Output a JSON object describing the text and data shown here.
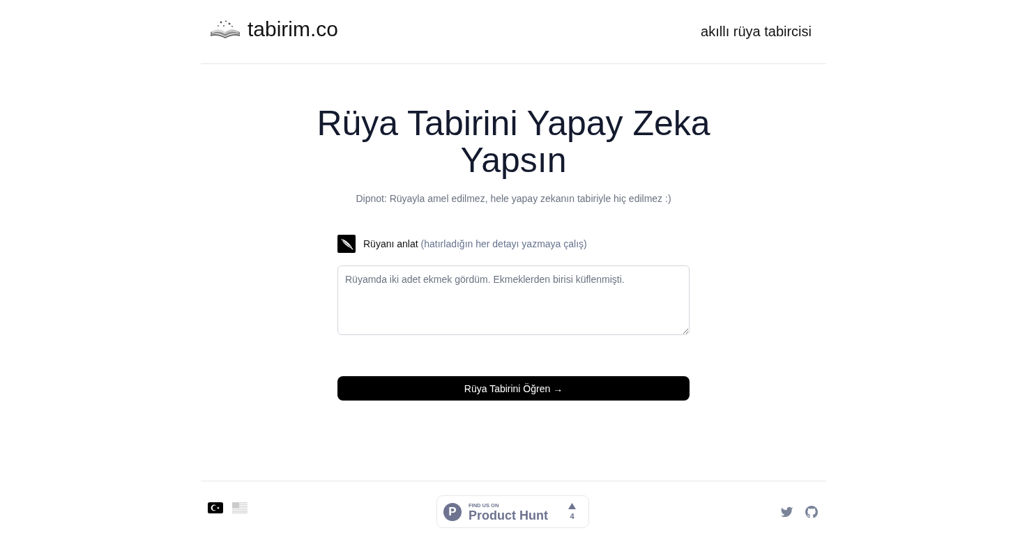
{
  "header": {
    "logo_text": "tabirim.co",
    "tagline": "akıllı rüya tabircisi"
  },
  "hero": {
    "title": "Rüya Tabirini Yapay Zeka Yapsın",
    "note": "Dipnot: Rüyayla amel edilmez, hele yapay zekanın tabiriyle hiç edilmez :)"
  },
  "form": {
    "label": "Rüyanı anlat",
    "hint": "(hatırladığın her detayı yazmaya çalış)",
    "dream_field": {
      "placeholder": "Rüyamda iki adet ekmek gördüm. Ekmeklerden birisi küflenmişti."
    },
    "submit_button": "Rüya Tabirini Öğren →"
  },
  "footer": {
    "languages": [
      {
        "kind": "turkish",
        "selected": true
      },
      {
        "kind": "english",
        "selected": false
      }
    ],
    "product_hunt": {
      "logo_letter": "P",
      "eyebrow": "FIND US ON",
      "name": "Product Hunt",
      "upvotes": "4"
    },
    "social": [
      {
        "kind": "twitter"
      },
      {
        "kind": "github"
      }
    ]
  }
}
